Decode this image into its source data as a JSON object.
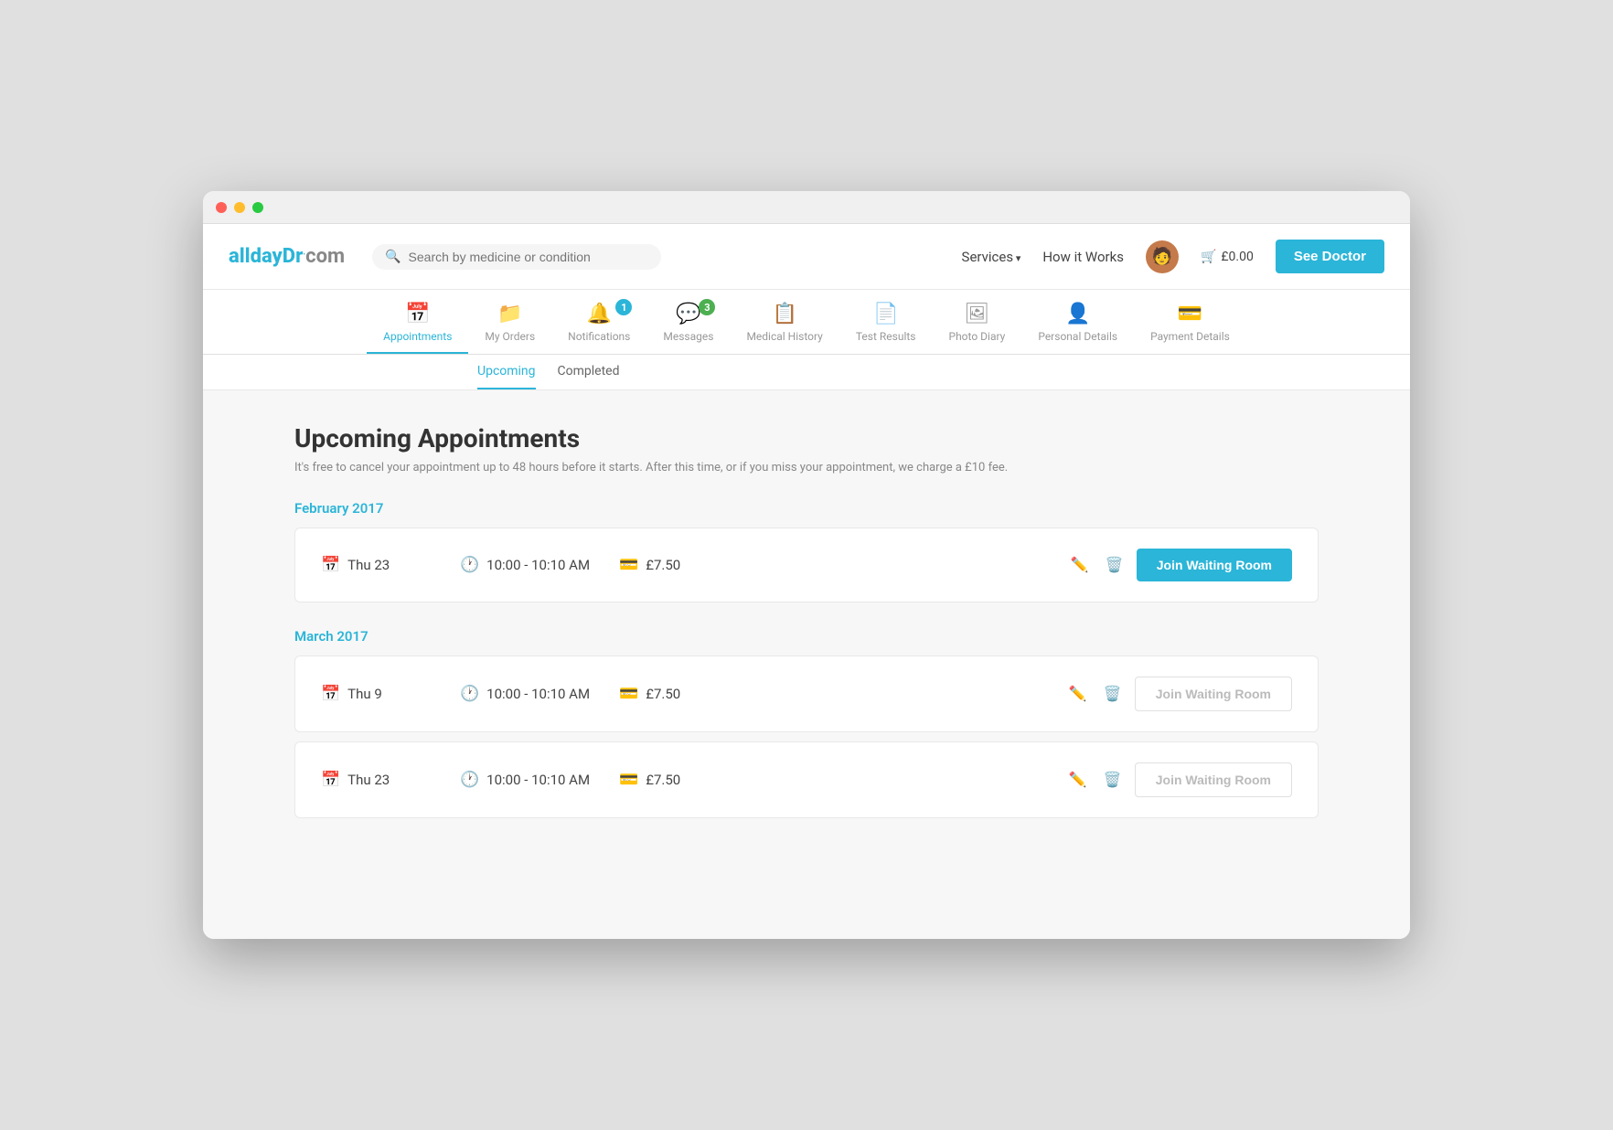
{
  "window": {
    "titlebar_buttons": [
      "red",
      "yellow",
      "green"
    ]
  },
  "topnav": {
    "logo": "alldayDr.com",
    "search_placeholder": "Search by medicine or condition",
    "services_label": "Services",
    "how_it_works_label": "How it Works",
    "cart_label": "£0.00",
    "see_doctor_label": "See Doctor"
  },
  "tabs": [
    {
      "id": "appointments",
      "label": "Appointments",
      "icon": "📅",
      "active": true,
      "badge": null
    },
    {
      "id": "my-orders",
      "label": "My Orders",
      "icon": "📁",
      "active": false,
      "badge": null
    },
    {
      "id": "notifications",
      "label": "Notifications",
      "icon": "🔔",
      "active": false,
      "badge": "1",
      "badge_color": "blue"
    },
    {
      "id": "messages",
      "label": "Messages",
      "icon": "💬",
      "active": false,
      "badge": "3",
      "badge_color": "green"
    },
    {
      "id": "medical-history",
      "label": "Medical History",
      "icon": "📋",
      "active": false,
      "badge": null
    },
    {
      "id": "test-results",
      "label": "Test Results",
      "icon": "📄",
      "active": false,
      "badge": null
    },
    {
      "id": "photo-diary",
      "label": "Photo Diary",
      "icon": "🖼",
      "active": false,
      "badge": null
    },
    {
      "id": "personal-details",
      "label": "Personal Details",
      "icon": "👤",
      "active": false,
      "badge": null
    },
    {
      "id": "payment-details",
      "label": "Payment Details",
      "icon": "💳",
      "active": false,
      "badge": null
    }
  ],
  "subnav": {
    "links": [
      {
        "label": "Upcoming",
        "active": true
      },
      {
        "label": "Completed",
        "active": false
      }
    ]
  },
  "main": {
    "page_title": "Upcoming Appointments",
    "page_subtitle": "It's free to cancel your appointment up to 48 hours before it starts. After this time, or if you miss your appointment, we charge a £10 fee.",
    "months": [
      {
        "label": "February 2017",
        "appointments": [
          {
            "day": "Thu 23",
            "time": "10:00 - 10:10 AM",
            "price": "£7.50",
            "join_active": true,
            "join_label": "Join Waiting Room"
          }
        ]
      },
      {
        "label": "March 2017",
        "appointments": [
          {
            "day": "Thu 9",
            "time": "10:00 - 10:10 AM",
            "price": "£7.50",
            "join_active": false,
            "join_label": "Join Waiting Room"
          },
          {
            "day": "Thu 23",
            "time": "10:00 - 10:10 AM",
            "price": "£7.50",
            "join_active": false,
            "join_label": "Join Waiting Room"
          }
        ]
      }
    ]
  }
}
